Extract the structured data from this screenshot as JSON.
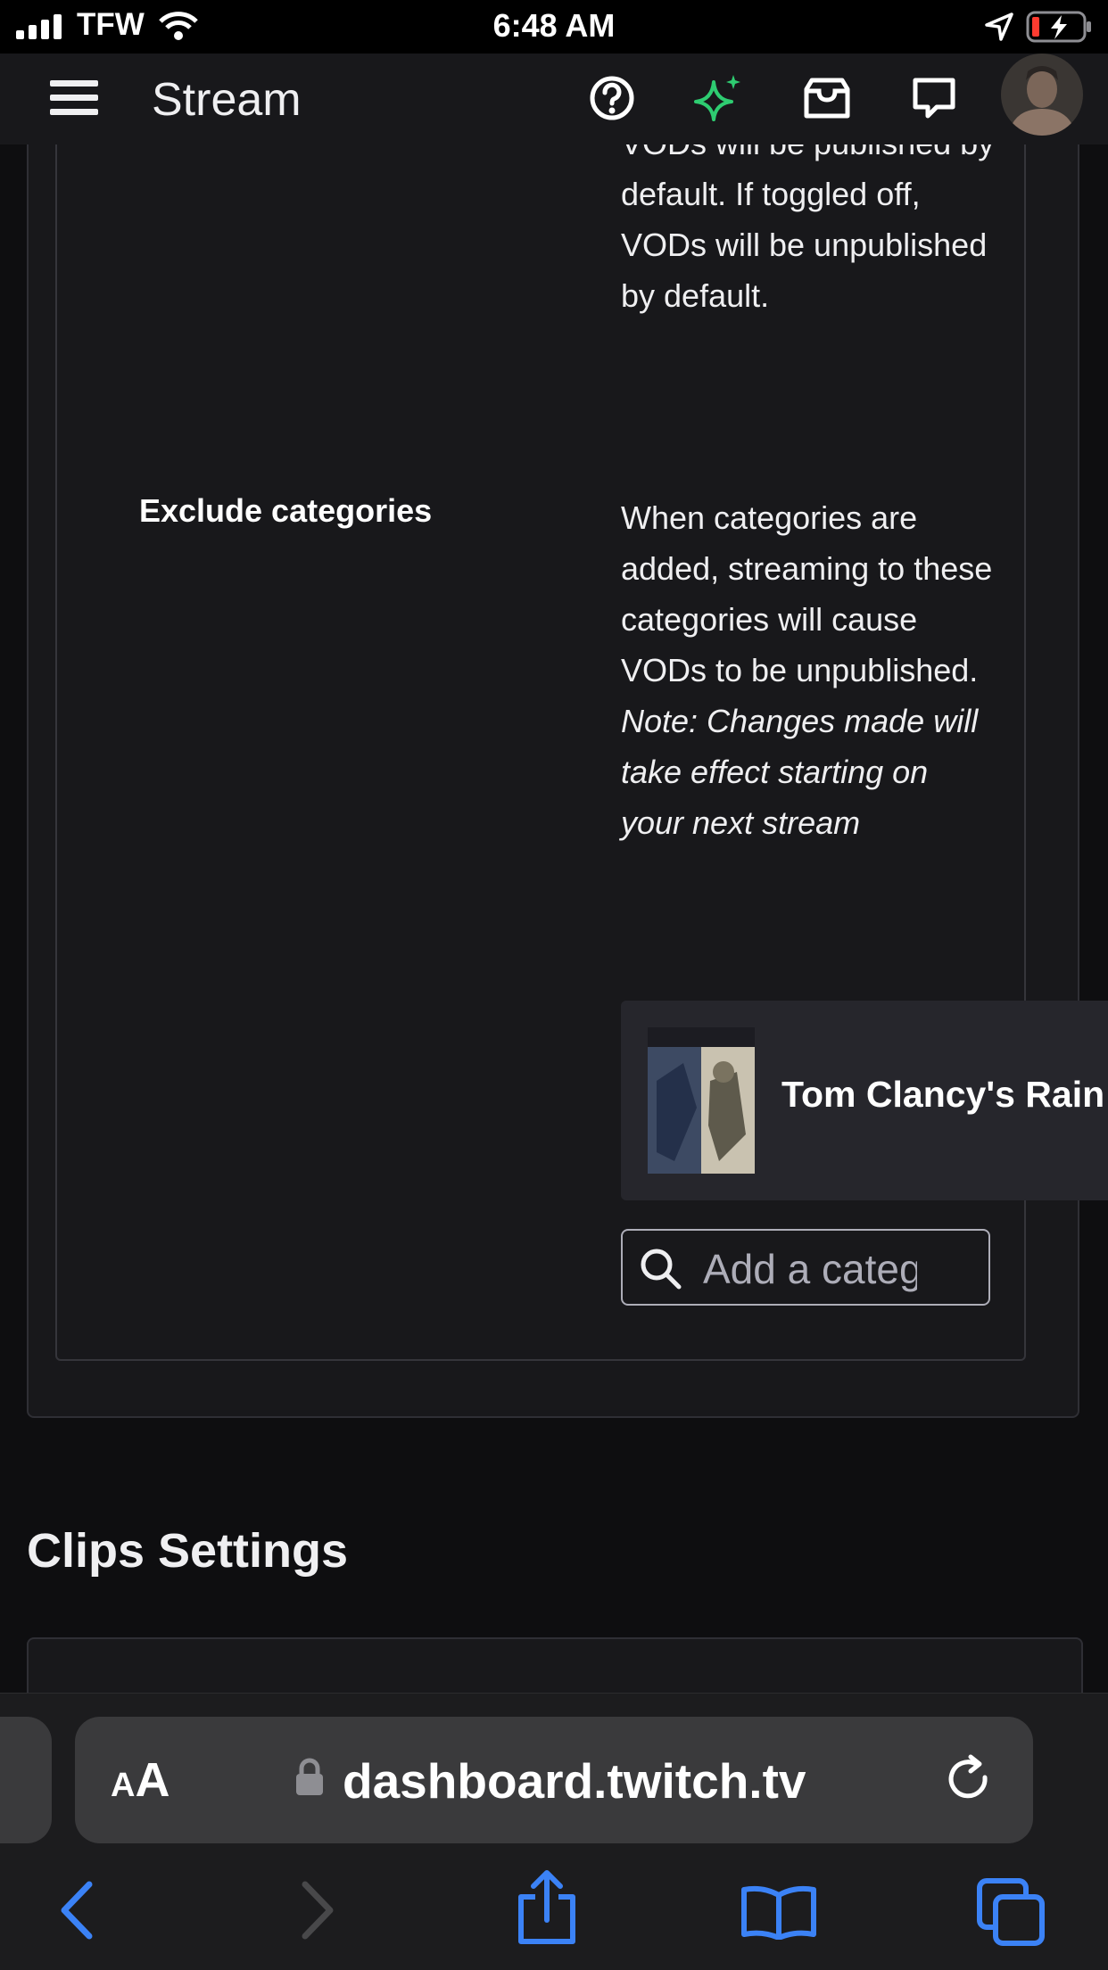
{
  "status_bar": {
    "carrier": "TFW",
    "time": "6:48 AM"
  },
  "header": {
    "title": "Stream"
  },
  "vod_section": {
    "description": "VODs will be published by default. If toggled off, VODs will be unpublished by default."
  },
  "exclude_categories": {
    "label": "Exclude categories",
    "description": "When categories are added, streaming to these categories will cause VODs to be unpublished.",
    "note": "Note: Changes made will take effect starting on your next stream",
    "categories": [
      {
        "name": "Tom Clancy's Rain"
      }
    ],
    "search_placeholder": "Add a category"
  },
  "clips": {
    "heading": "Clips Settings"
  },
  "browser": {
    "aa_small": "A",
    "aa_big": "A",
    "url": "dashboard.twitch.tv"
  },
  "colors": {
    "accent_green": "#2ecc71",
    "ios_blue": "#3b82f6"
  }
}
